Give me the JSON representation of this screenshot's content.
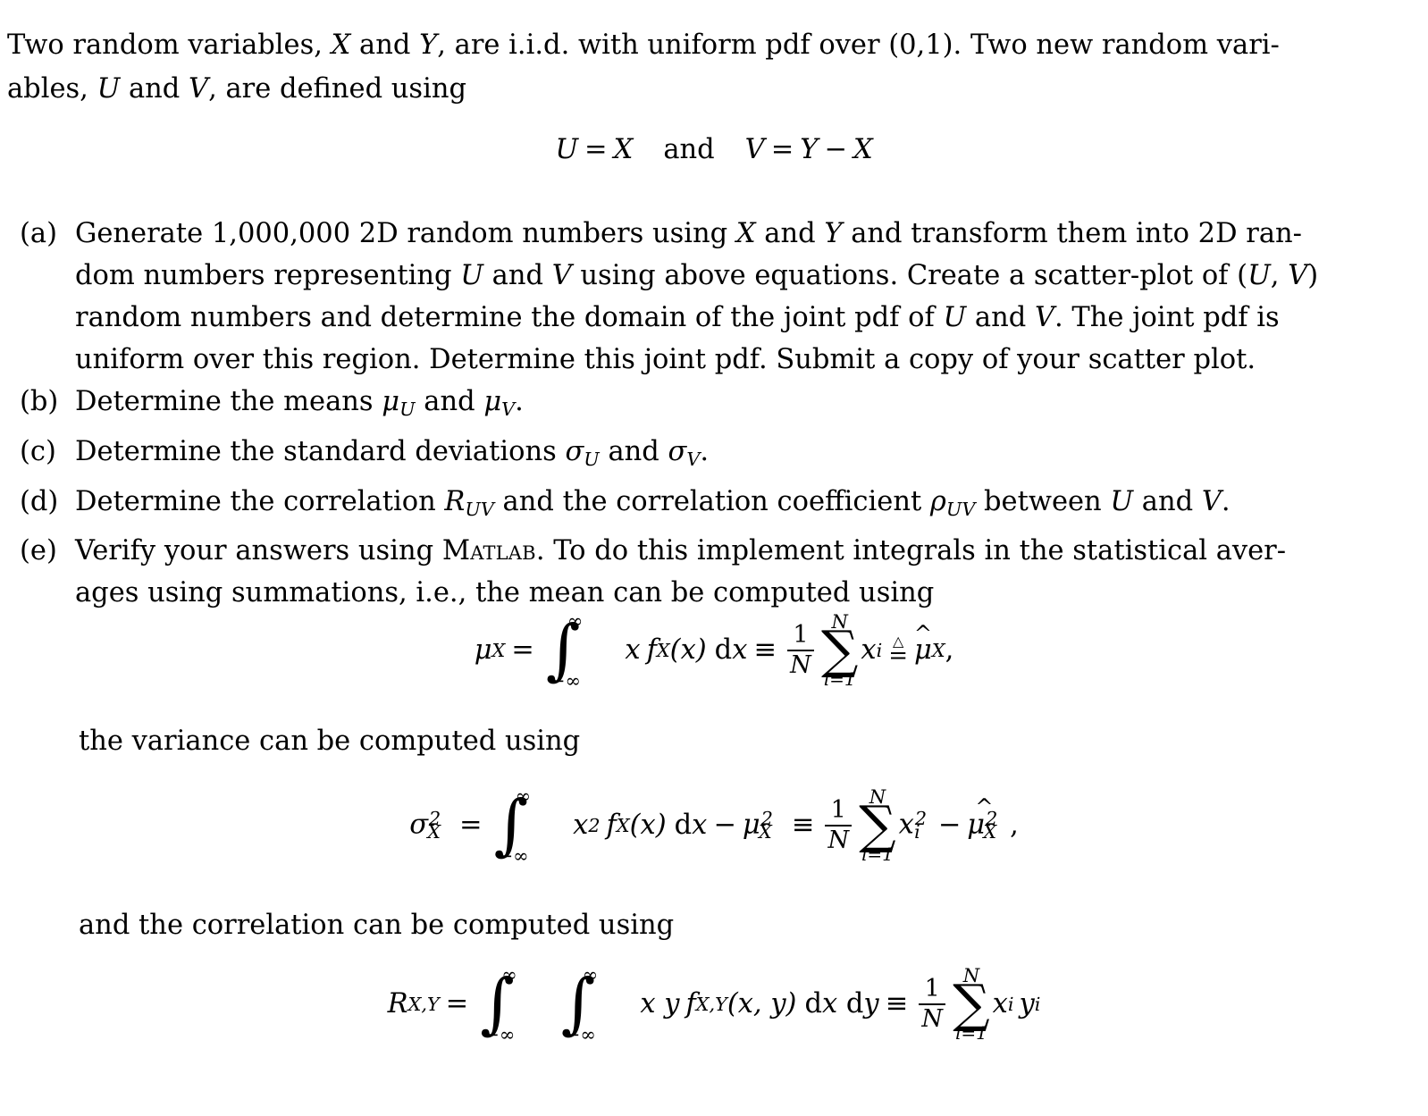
{
  "document": {
    "type": "homework-problem",
    "intro": {
      "line1_a": "Two random variables, ",
      "var_x": "X",
      "line1_b": " and ",
      "var_y": "Y",
      "line1_c": ", are i.i.d. with uniform pdf over (0,1).  Two new random vari-",
      "line2_a": "ables, ",
      "var_u": "U",
      "line2_b": " and ",
      "var_v": "V",
      "line2_c": ", are defined using"
    },
    "equation_uv": {
      "lhs1": "U",
      "eq1": "=",
      "rhs1": "X",
      "conjunction": "and",
      "lhs2": "V",
      "eq2": "=",
      "rhs2_a": "Y",
      "minus": "−",
      "rhs2_b": "X"
    },
    "items": [
      {
        "label": "(a)",
        "lines": [
          "Generate 1,000,000 2D random numbers using X and Y and transform them into 2D ran-",
          "dom numbers representing U and V using above equations. Create a scatter-plot of (U,V)",
          "random numbers and determine the domain of the joint pdf of U and V. The joint pdf is",
          "uniform over this region. Determine this joint pdf. Submit a copy of your scatter plot."
        ],
        "seg": {
          "a1_1": "Generate 1,000,000 2D random numbers using ",
          "a1_x": "X",
          "a1_2": " and ",
          "a1_y": "Y",
          "a1_3": " and transform them into 2D ran-",
          "a2_1": "dom numbers representing ",
          "a2_u": "U",
          "a2_2": " and ",
          "a2_v": "V",
          "a2_3": " using above equations. Create a scatter-plot of (",
          "a2_u2": "U",
          "a2_4": ", ",
          "a2_v2": "V",
          "a2_5": ")",
          "a3_1": "random numbers and determine the domain of the joint pdf of ",
          "a3_u": "U",
          "a3_2": " and ",
          "a3_v": "V",
          "a3_3": ". The joint pdf is",
          "a4": "uniform over this region. Determine this joint pdf. Submit a copy of your scatter plot."
        }
      },
      {
        "label": "(b)",
        "seg": {
          "b1": "Determine the means ",
          "mu1": "μ",
          "sub1": "U",
          "b2": " and ",
          "mu2": "μ",
          "sub2": "V",
          "b3": "."
        }
      },
      {
        "label": "(c)",
        "seg": {
          "c1": "Determine the standard deviations ",
          "sig1": "σ",
          "sub1": "U",
          "c2": " and ",
          "sig2": "σ",
          "sub2": "V",
          "c3": "."
        }
      },
      {
        "label": "(d)",
        "seg": {
          "d1": "Determine the correlation ",
          "R": "R",
          "Rsub": "UV",
          "d2": " and the correlation coefficient ",
          "rho": "ρ",
          "rhosub": "UV",
          "d3": " between ",
          "u": "U",
          "d4": " and ",
          "v": "V",
          "d5": "."
        }
      },
      {
        "label": "(e)",
        "seg": {
          "e1": "Verify your answers using ",
          "matlab": "Matlab",
          "e2": ".  To do this implement integrals in the statistical aver-",
          "e3": "ages using summations, i.e., the mean can be computed using"
        }
      }
    ],
    "paragraphs": {
      "variance": "the variance can be computed using",
      "correlation": "and the correlation can be computed using"
    },
    "equation_mean": {
      "lhs_mu": "μ",
      "lhs_sub": "X",
      "eq": "=",
      "int_top": "∞",
      "int_bot": "−∞",
      "integrand_x": "x",
      "integrand_f": "f",
      "integrand_fsub": "X",
      "integrand_arg": "(x)",
      "differential": "dx",
      "equiv": "≡",
      "frac_num": "1",
      "frac_den": "N",
      "sum_top": "N",
      "sum_sym": "∑",
      "sum_bot": "i=1",
      "sum_term": "x",
      "sum_term_sub": "i",
      "def_tri": "△",
      "def_eq": "=",
      "hat_mu": "μ",
      "hat_sub": "X",
      "trailing": ","
    },
    "equation_variance": {
      "lhs_sigma": "σ",
      "lhs_sup": "2",
      "lhs_sub": "X",
      "eq": "=",
      "int_top": "∞",
      "int_bot": "−∞",
      "integrand_x": "x",
      "integrand_x_sup": "2",
      "integrand_f": "f",
      "integrand_fsub": "X",
      "integrand_arg": "(x)",
      "differential": "dx",
      "minus": "−",
      "mu": "μ",
      "mu_sup": "2",
      "mu_sub": "X",
      "equiv": "≡",
      "frac_num": "1",
      "frac_den": "N",
      "sum_top": "N",
      "sum_sym": "∑",
      "sum_bot": "i=1",
      "sum_term": "x",
      "sum_term_sub": "i",
      "sum_term_sup": "2",
      "minus2": "−",
      "hat_mu": "μ",
      "hat_sup": "2",
      "hat_sub": "X",
      "trailing": ","
    },
    "equation_correlation": {
      "lhs_R": "R",
      "lhs_sub": "X,Y",
      "eq": "=",
      "int1_top": "∞",
      "int1_bot": "−∞",
      "int2_top": "∞",
      "int2_bot": "−∞",
      "integrand_xy": "x y",
      "integrand_f": "f",
      "integrand_fsub": "X,Y",
      "integrand_arg": "(x, y)",
      "differential": "dx dy",
      "equiv": "≡",
      "frac_num": "1",
      "frac_den": "N",
      "sum_top": "N",
      "sum_sym": "∑",
      "sum_bot": "i=1",
      "sum_term_x": "x",
      "sum_term_xsub": "i",
      "sum_term_y": "y",
      "sum_term_ysub": "i"
    },
    "colors": {
      "text": "#000000",
      "background": "#ffffff"
    }
  }
}
